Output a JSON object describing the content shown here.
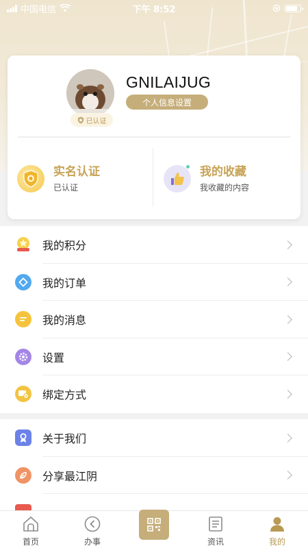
{
  "status_bar": {
    "carrier": "中国电信",
    "time": "下午 8:52"
  },
  "profile": {
    "username": "GNILAIJUG",
    "verified_badge": "已认证",
    "settings_button": "个人信息设置"
  },
  "features": [
    {
      "title": "实名认证",
      "subtitle": "已认证",
      "icon": "shield-medal-icon"
    },
    {
      "title": "我的收藏",
      "subtitle": "我收藏的内容",
      "icon": "thumbs-up-icon"
    }
  ],
  "menu_group_1": [
    {
      "label": "我的积分",
      "icon": "points-star-icon"
    },
    {
      "label": "我的订单",
      "icon": "order-diamond-icon"
    },
    {
      "label": "我的消息",
      "icon": "message-bubble-icon"
    },
    {
      "label": "设置",
      "icon": "gear-icon"
    },
    {
      "label": "绑定方式",
      "icon": "bind-card-icon"
    }
  ],
  "menu_group_2": [
    {
      "label": "关于我们",
      "icon": "about-badge-icon"
    },
    {
      "label": "分享最江阴",
      "icon": "share-leaf-icon"
    }
  ],
  "tabbar": [
    {
      "label": "首页",
      "icon": "home-icon"
    },
    {
      "label": "办事",
      "icon": "service-icon"
    },
    {
      "label": "",
      "icon": "qr-scan-icon"
    },
    {
      "label": "资讯",
      "icon": "news-icon"
    },
    {
      "label": "我的",
      "icon": "person-icon"
    }
  ],
  "colors": {
    "accent": "#c6ae7a",
    "accent_text": "#c7a357",
    "background": "#f2f2f2"
  }
}
